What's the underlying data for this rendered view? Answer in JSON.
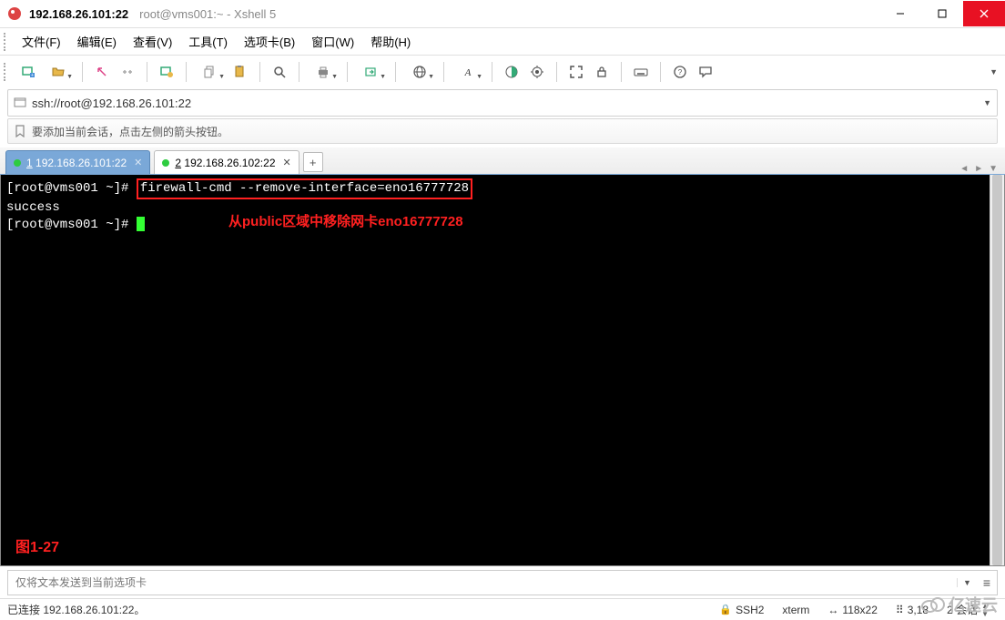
{
  "window": {
    "title": "192.168.26.101:22",
    "subtitle": "root@vms001:~ - Xshell 5"
  },
  "menu": {
    "items": [
      "文件(F)",
      "编辑(E)",
      "查看(V)",
      "工具(T)",
      "选项卡(B)",
      "窗口(W)",
      "帮助(H)"
    ]
  },
  "address": {
    "url": "ssh://root@192.168.26.101:22"
  },
  "infobar": {
    "text": "要添加当前会话，点击左侧的箭头按钮。"
  },
  "tabs": [
    {
      "num": "1",
      "label": "192.168.26.101:22",
      "active": true
    },
    {
      "num": "2",
      "label": "192.168.26.102:22",
      "active": false
    }
  ],
  "terminal": {
    "prompt1": "[root@vms001 ~]# ",
    "command": "firewall-cmd --remove-interface=eno16777728",
    "output": "success",
    "prompt2": "[root@vms001 ~]# ",
    "annotation": "从public区域中移除网卡eno16777728",
    "figlabel": "图1-27"
  },
  "sendbar": {
    "placeholder": "仅将文本发送到当前选项卡"
  },
  "status": {
    "connected": "已连接 192.168.26.101:22。",
    "protocol": "SSH2",
    "termtype": "xterm",
    "size": "118x22",
    "pos": "3,18",
    "sessions": "2 会话"
  },
  "watermark": "亿速云"
}
